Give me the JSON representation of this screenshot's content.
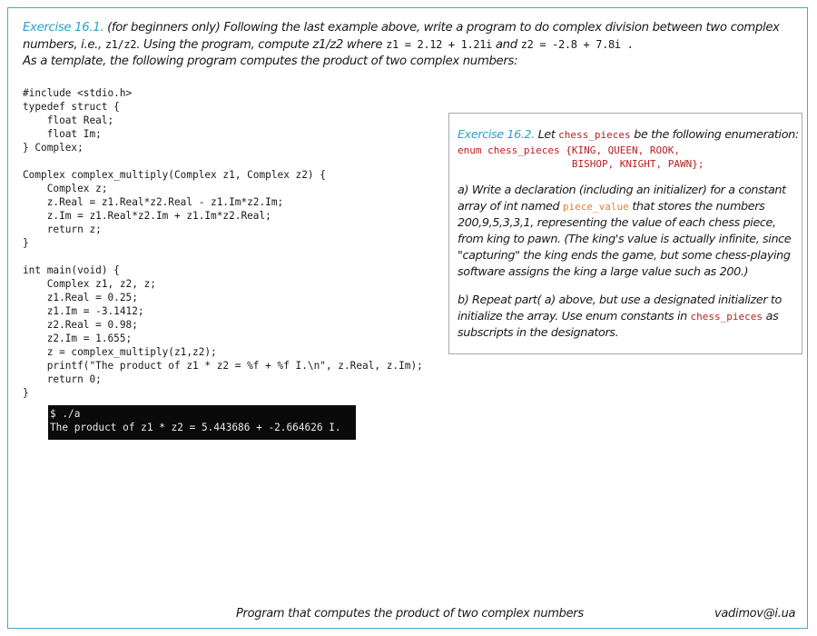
{
  "exercise1": {
    "label": "Exercise 16.1.",
    "text_a": " (for beginners only) Following the last example above, write a program to do complex division between two complex numbers, i.e., ",
    "expr_div": "z1/z2",
    "text_b": ". Using the program, compute z1/z2 where ",
    "expr_z1": "z1 = 2.12 + 1.21i",
    "text_c": " and ",
    "expr_z2": "z2 = -2.8 + 7.8i .",
    "template_line": "As a template, the following program computes the product of two complex numbers:"
  },
  "code": {
    "lines": [
      "#include <stdio.h>",
      "typedef struct {",
      "    float Real;",
      "    float Im;",
      "} Complex;",
      "",
      "Complex complex_multiply(Complex z1, Complex z2) {",
      "    Complex z;",
      "    z.Real = z1.Real*z2.Real - z1.Im*z2.Im;",
      "    z.Im = z1.Real*z2.Im + z1.Im*z2.Real;",
      "    return z;",
      "}",
      "",
      "int main(void) {",
      "    Complex z1, z2, z;",
      "    z1.Real = 0.25;",
      "    z1.Im = -3.1412;",
      "    z2.Real = 0.98;",
      "    z2.Im = 1.655;",
      "    z = complex_multiply(z1,z2);",
      "    printf(\"The product of z1 * z2 = %f + %f I.\\n\", z.Real, z.Im);",
      "    return 0;",
      "}"
    ]
  },
  "terminal": {
    "prompt": "$ ./a",
    "output": "The product of z1 * z2 = 5.443686 + -2.664626 I."
  },
  "exercise2": {
    "label": "Exercise 16.2.",
    "text_let": " Let ",
    "enum_name": "chess_pieces",
    "text_be": " be the following enumeration:",
    "enum_line1": "enum chess_pieces {KING, QUEEN, ROOK,",
    "enum_line2": "                   BISHOP, KNIGHT, PAWN};",
    "part_a1": "a) Write a declaration (including an initializer) for a constant array of int named ",
    "array_name": "piece_value",
    "part_a2": " that stores the numbers 200,9,5,3,3,1, representing the value of each chess piece, from king to pawn. (The king's value is actually infinite, since \"capturing\" the king ends the game, but some chess-playing software assigns the king a large value such as 200.)",
    "part_b1": "b) Repeat part( a) above, but use a designated initializer to initialize the array. Use enum constants in ",
    "enum_ref": "chess_pieces",
    "part_b2": " as subscripts in the designators."
  },
  "footer": {
    "caption": "Program that computes the product of two complex numbers",
    "email": "vadimov@i.ua"
  },
  "colors": {
    "border": "#4ba8c8",
    "accent": "#2ea0c8",
    "code_red": "#b82020",
    "code_orange": "#e0803a",
    "terminal_bg": "#0a0a0a"
  }
}
